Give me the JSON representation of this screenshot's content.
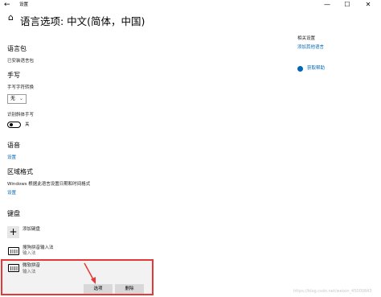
{
  "window": {
    "title": "设置",
    "back_glyph": "←",
    "minimize_glyph": "—",
    "maximize_glyph": "☐",
    "close_glyph": "✕"
  },
  "header": {
    "home_glyph": "⌂",
    "title": "语言选项: 中文(简体，中国)"
  },
  "sections": {
    "language_pack": {
      "heading": "语言包",
      "status": "已安装语言包"
    },
    "handwriting": {
      "heading": "手写",
      "conversion_label": "手写字符转换",
      "conversion_value": "无",
      "recognize_label": "识别斜体手写",
      "toggle_state": "关"
    },
    "speech": {
      "heading": "语音",
      "settings_link": "设置"
    },
    "regional_format": {
      "heading": "区域格式",
      "description": "Windows 根据此语言设置日期和时间格式",
      "settings_link": "设置"
    },
    "keyboard": {
      "heading": "键盘",
      "add_label": "添加键盘",
      "add_glyph": "+",
      "items": [
        {
          "name": "搜狗拼音输入法",
          "subtitle": "输入法"
        },
        {
          "name": "微软拼音",
          "subtitle": "输入法"
        }
      ],
      "options_button": "选项",
      "remove_button": "删除"
    }
  },
  "related": {
    "heading": "相关设置",
    "add_speech_link": "添加其他语言",
    "help_link": "获取帮助"
  },
  "colors": {
    "link": "#0067b8",
    "highlight_border": "#e53935"
  },
  "watermark": "https://blog.csdn.net/weixin_45000843"
}
